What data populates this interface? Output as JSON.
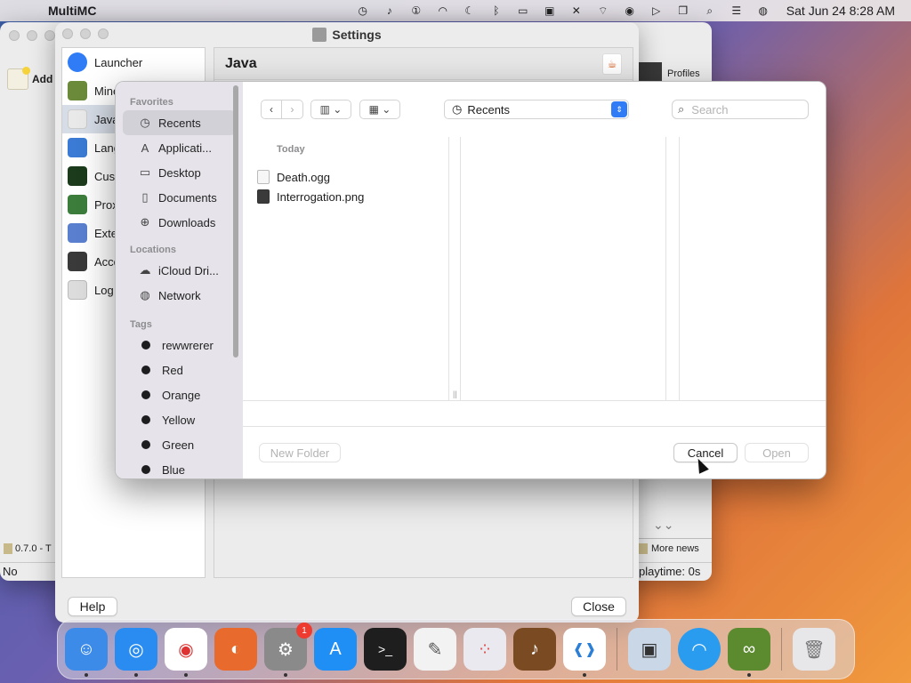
{
  "menubar": {
    "app_name": "MultiMC",
    "clock": "Sat Jun 24  8:28 AM"
  },
  "multimc": {
    "add_label": "Add",
    "profiles_label": "Profiles",
    "version_label": "0.7.0 - T",
    "status_left": "No instanc",
    "more_news": "More news",
    "playtime": "playtime: 0s"
  },
  "settings": {
    "title": "Settings",
    "header": "Java",
    "sidebar": [
      {
        "label": "Launcher",
        "icon": "launcher-icon",
        "color": "#2f7cf6"
      },
      {
        "label": "Mine",
        "icon": "minecraft-icon",
        "color": "#6b8a3a"
      },
      {
        "label": "Java",
        "icon": "java-icon",
        "color": "#e9e9e9"
      },
      {
        "label": "Lang",
        "icon": "language-icon",
        "color": "#3b7bd5"
      },
      {
        "label": "Cust",
        "icon": "terminal-icon",
        "color": "#1c3a1c"
      },
      {
        "label": "Prox",
        "icon": "proxy-icon",
        "color": "#3c7d3c"
      },
      {
        "label": "Exte",
        "icon": "extension-icon",
        "color": "#5a7fcf"
      },
      {
        "label": "Acco",
        "icon": "account-icon",
        "color": "#3a3a3a"
      },
      {
        "label": "Log",
        "icon": "log-icon",
        "color": "#dcdcdc"
      }
    ],
    "help_button": "Help",
    "close_button": "Close"
  },
  "dialog": {
    "sections": {
      "favorites": "Favorites",
      "locations": "Locations",
      "tags": "Tags"
    },
    "favorites": [
      {
        "label": "Recents",
        "glyph": "◷",
        "selected": true
      },
      {
        "label": "Applicati...",
        "glyph": "A",
        "selected": false
      },
      {
        "label": "Desktop",
        "glyph": "▭",
        "selected": false
      },
      {
        "label": "Documents",
        "glyph": "▯",
        "selected": false
      },
      {
        "label": "Downloads",
        "glyph": "⊕",
        "selected": false
      }
    ],
    "locations": [
      {
        "label": "iCloud Dri...",
        "glyph": "☁"
      },
      {
        "label": "Network",
        "glyph": "◍"
      }
    ],
    "tags": [
      "rewwrerer",
      "Red",
      "Orange",
      "Yellow",
      "Green",
      "Blue"
    ],
    "location_popup": "Recents",
    "search_placeholder": "Search",
    "column_header": "Today",
    "files": [
      "Death.ogg",
      "Interrogation.png"
    ],
    "new_folder": "New Folder",
    "cancel": "Cancel",
    "open": "Open"
  },
  "dock": [
    {
      "name": "finder-icon",
      "color": "#3d8be8",
      "glyph": "☺"
    },
    {
      "name": "safari-icon",
      "color": "#2a8cf0",
      "glyph": "◎"
    },
    {
      "name": "chrome-icon",
      "color": "#ffffff",
      "glyph": "◉"
    },
    {
      "name": "firefox-icon",
      "color": "#e86a2c",
      "glyph": "◐"
    },
    {
      "name": "system-settings-icon",
      "color": "#8a8a8a",
      "glyph": "⚙",
      "badge": "1"
    },
    {
      "name": "app-store-icon",
      "color": "#1f8ef5",
      "glyph": "A"
    },
    {
      "name": "terminal-icon",
      "color": "#1e1e1e",
      "glyph": ">_"
    },
    {
      "name": "textedit-icon",
      "color": "#f2f2f2",
      "glyph": "✎"
    },
    {
      "name": "launchpad-icon",
      "color": "#e9e9ef",
      "glyph": "⁘"
    },
    {
      "name": "garageband-icon",
      "color": "#7a4a22",
      "glyph": "♪"
    },
    {
      "name": "vscode-icon",
      "color": "#ffffff",
      "glyph": "❰❱"
    },
    {
      "name": "preview-icon",
      "color": "#c9d7e6",
      "glyph": "▣"
    },
    {
      "name": "wifi-icon",
      "color": "#2a9cf0",
      "glyph": "◠"
    },
    {
      "name": "multimc-icon",
      "color": "#5c8a2f",
      "glyph": "∞"
    },
    {
      "name": "trash-icon",
      "color": "#e7e7ea",
      "glyph": "🗑"
    }
  ]
}
